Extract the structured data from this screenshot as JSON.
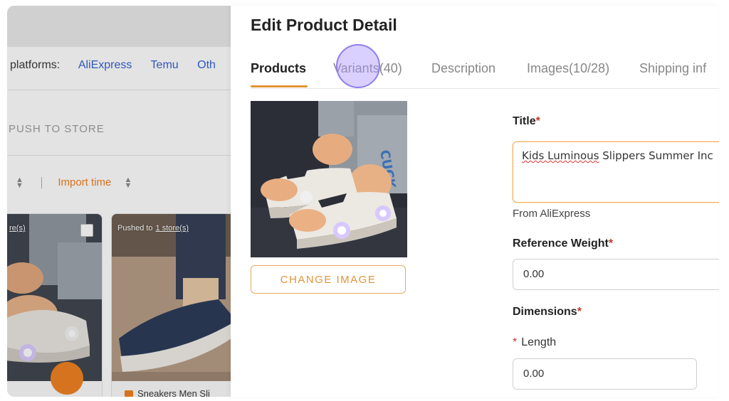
{
  "background": {
    "platforms_label": "platforms:",
    "platforms": [
      "AliExpress",
      "Temu",
      "Oth"
    ],
    "push_to_store": "PUSH TO STORE",
    "sort_import_time": "Import time",
    "card1_tag": "re(s)",
    "card2_tag_prefix": "Pushed to",
    "card2_tag_link": "1 store(s)",
    "card2_footer": "Sneakers Men Sli"
  },
  "drawer": {
    "title": "Edit Product Detail",
    "tabs": [
      {
        "label": "Products",
        "active": true
      },
      {
        "label": "Variants(40)",
        "active": false
      },
      {
        "label": "Description",
        "active": false
      },
      {
        "label": "Images(10/28)",
        "active": false
      },
      {
        "label": "Shipping inf",
        "active": false
      }
    ],
    "change_image_label": "CHANGE IMAGE",
    "form": {
      "title_label": "Title",
      "title_value_part1": "Kids Luminous",
      "title_value_part2": "Slippers Summer Inc",
      "from_source": "From AliExpress",
      "weight_label": "Reference Weight",
      "weight_value": "0.00",
      "dimensions_label": "Dimensions",
      "length_label": "Length",
      "length_value": "0.00",
      "required_mark": "*"
    }
  },
  "colors": {
    "accent": "#e39437",
    "link": "#2e5dd6",
    "required": "#c0392b",
    "cursor": "#8f7ef0"
  }
}
